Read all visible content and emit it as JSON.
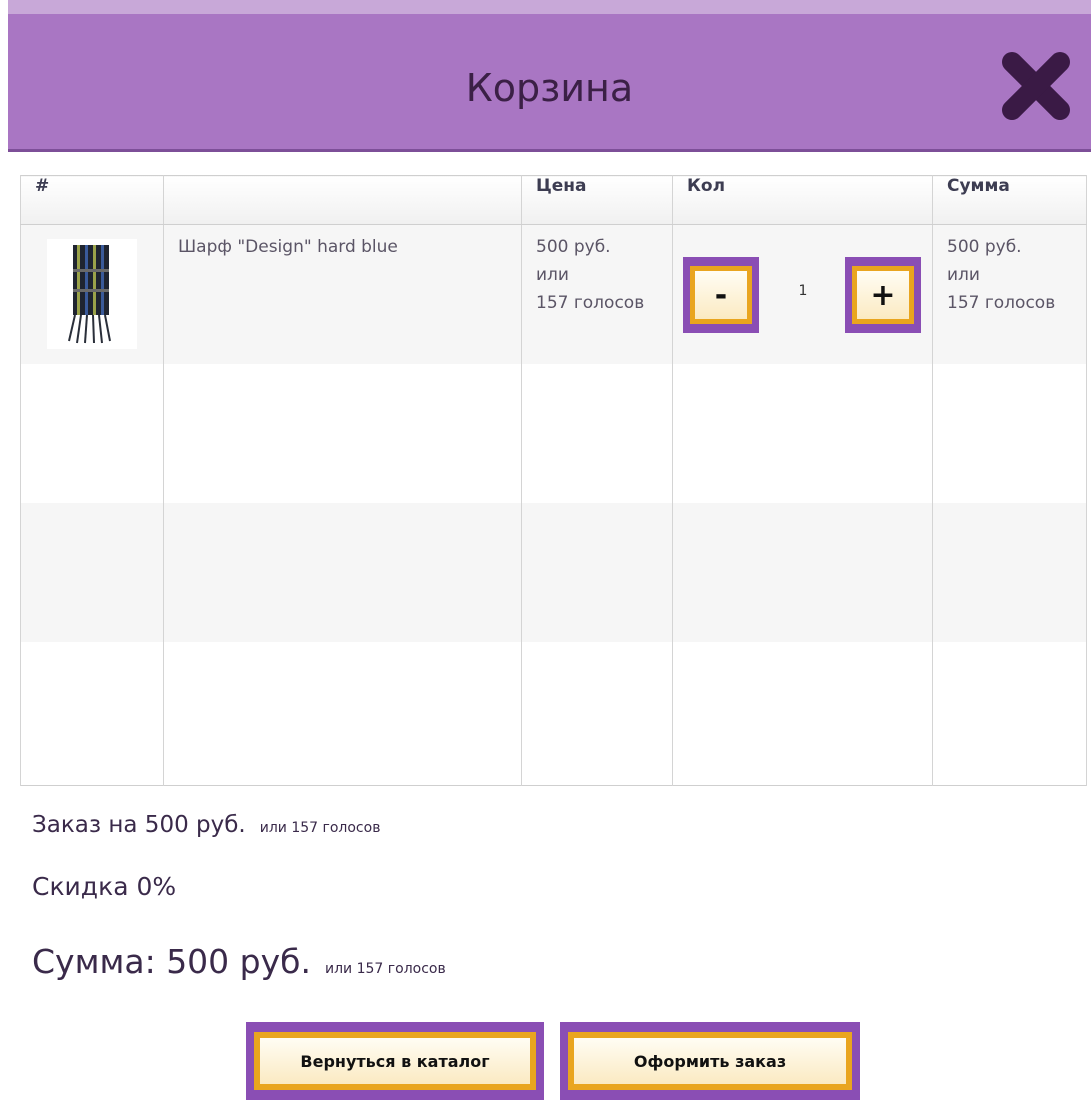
{
  "header": {
    "title": "Корзина",
    "close_icon": "close-icon"
  },
  "table": {
    "columns": [
      "#",
      "",
      "Цена",
      "Кол",
      "Сумма"
    ],
    "rows": [
      {
        "image": "scarf-thumbnail",
        "name": "Шарф \"Design\" hard blue",
        "price_line1": "500 руб.",
        "price_line2": "или",
        "price_line3": "157 голосов",
        "qty_minus_label": "-",
        "qty": "1",
        "qty_plus_label": "+",
        "sum_line1": "500 руб.",
        "sum_line2": "или",
        "sum_line3": "157 голосов"
      }
    ]
  },
  "summary": {
    "order_label": "Заказ на 500 руб.",
    "order_alt": "или 157 голосов",
    "discount_label": "Скидка 0%",
    "total_label": "Сумма: 500 руб.",
    "total_alt": "или 157 голосов"
  },
  "actions": {
    "back_label": "Вернуться в каталог",
    "checkout_label": "Оформить заказ"
  },
  "colors": {
    "header_bg": "#a976c3",
    "button_frame": "#8a4eb4",
    "button_border": "#e9a51f"
  }
}
